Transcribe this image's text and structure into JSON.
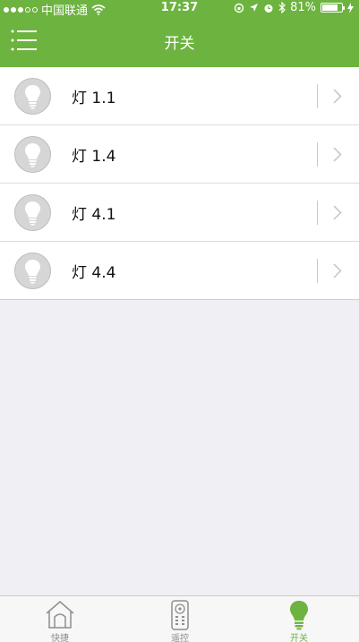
{
  "status_bar": {
    "carrier": "中国联通",
    "time": "17:37",
    "battery": "81%",
    "battery_level": 0.81
  },
  "nav": {
    "title": "开关",
    "menu_icon": "menu-icon"
  },
  "lights": [
    {
      "label": "灯 1.1",
      "icon": "light-bulb-icon"
    },
    {
      "label": "灯 1.4",
      "icon": "light-bulb-icon"
    },
    {
      "label": "灯 4.1",
      "icon": "light-bulb-icon"
    },
    {
      "label": "灯 4.4",
      "icon": "light-bulb-icon"
    }
  ],
  "tabs": [
    {
      "label": "快捷",
      "icon": "home-icon",
      "active": false
    },
    {
      "label": "遥控",
      "icon": "remote-icon",
      "active": false
    },
    {
      "label": "开关",
      "icon": "bulb-tab-icon",
      "active": true
    }
  ],
  "colors": {
    "accent": "#6db33f",
    "background": "#efeff4"
  }
}
